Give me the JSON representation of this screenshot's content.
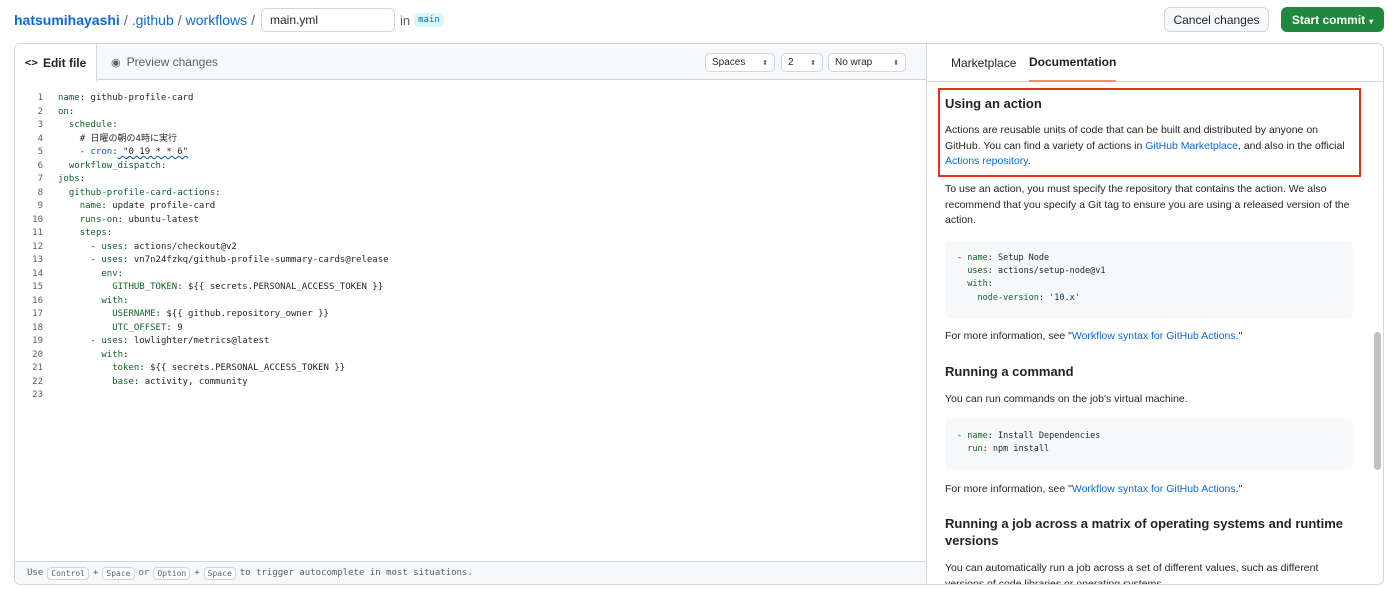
{
  "breadcrumb": {
    "owner": "hatsumihayashi",
    "dir1": ".github",
    "dir2": "workflows",
    "sep": "/",
    "filename": "main.yml",
    "in_text": "in",
    "branch": "main"
  },
  "actions": {
    "cancel": "Cancel changes",
    "commit": "Start commit",
    "commit_caret": "▾"
  },
  "editor": {
    "tab_edit": "Edit file",
    "tab_edit_icon": "<>",
    "tab_preview": "Preview changes",
    "tab_preview_icon": "◉",
    "indent_mode": "Spaces",
    "indent_size": "2",
    "wrap_mode": "No wrap",
    "select_arrow": "⬍",
    "footer": {
      "use": "Use",
      "key1": "Control",
      "plus1": "+",
      "key2": "Space",
      "or": "or",
      "key3": "Option",
      "plus2": "+",
      "key4": "Space",
      "tail": "to trigger autocomplete in most situations."
    }
  },
  "code_lines": [
    {
      "n": "1",
      "indent": "",
      "key": "name",
      "val": " github-profile-card"
    },
    {
      "n": "2",
      "indent": "",
      "key": "on",
      "val": ""
    },
    {
      "n": "3",
      "indent": "  ",
      "key": "schedule",
      "val": ""
    },
    {
      "n": "4",
      "indent": "    ",
      "key": "",
      "val": "# 日曜の朝の4時に実行"
    },
    {
      "n": "5",
      "indent": "    - ",
      "key": "cron",
      "val": " \"0 19 * * 6\""
    },
    {
      "n": "6",
      "indent": "  ",
      "key": "workflow_dispatch",
      "val": ""
    },
    {
      "n": "7",
      "indent": "",
      "key": "jobs",
      "val": ""
    },
    {
      "n": "8",
      "indent": "  ",
      "key": "github-profile-card-actions",
      "val": ""
    },
    {
      "n": "9",
      "indent": "    ",
      "key": "name",
      "val": " update profile-card"
    },
    {
      "n": "10",
      "indent": "    ",
      "key": "runs-on",
      "val": " ubuntu-latest"
    },
    {
      "n": "11",
      "indent": "    ",
      "key": "steps",
      "val": ""
    },
    {
      "n": "12",
      "indent": "      - ",
      "key": "uses",
      "val": " actions/checkout@v2"
    },
    {
      "n": "13",
      "indent": "      - ",
      "key": "uses",
      "val": " vn7n24fzkq/github-profile-summary-cards@release"
    },
    {
      "n": "14",
      "indent": "        ",
      "key": "env",
      "val": ""
    },
    {
      "n": "15",
      "indent": "          ",
      "key": "GITHUB_TOKEN",
      "val": " ${{ secrets.PERSONAL_ACCESS_TOKEN }}"
    },
    {
      "n": "16",
      "indent": "        ",
      "key": "with",
      "val": ""
    },
    {
      "n": "17",
      "indent": "          ",
      "key": "USERNAME",
      "val": " ${{ github.repository_owner }}"
    },
    {
      "n": "18",
      "indent": "          ",
      "key": "UTC_OFFSET",
      "val": " 9"
    },
    {
      "n": "19",
      "indent": "      - ",
      "key": "uses",
      "val": " lowlighter/metrics@latest"
    },
    {
      "n": "20",
      "indent": "        ",
      "key": "with",
      "val": ""
    },
    {
      "n": "21",
      "indent": "          ",
      "key": "token",
      "val": " ${{ secrets.PERSONAL_ACCESS_TOKEN }}"
    },
    {
      "n": "22",
      "indent": "          ",
      "key": "base",
      "val": " activity, community"
    },
    {
      "n": "23",
      "indent": "",
      "key": "",
      "val": ""
    }
  ],
  "docs": {
    "tab_marketplace": "Marketplace",
    "tab_documentation": "Documentation",
    "s1_title": "Using an action",
    "s1_p1_a": "Actions are reusable units of code that can be built and distributed by anyone on GitHub. You can find a variety of actions in ",
    "s1_p1_link1": "GitHub Marketplace",
    "s1_p1_b": ", and also in the official ",
    "s1_p1_link2": "Actions repository",
    "s1_p1_c": ".",
    "s1_p2": "To use an action, you must specify the repository that contains the action. We also recommend that you specify a Git tag to ensure you are using a released version of the action.",
    "code1": [
      {
        "pre": "- ",
        "key": "name",
        "val": " Setup Node",
        "str": false
      },
      {
        "pre": "  ",
        "key": "uses",
        "val": " actions/setup-node@v1",
        "str": false
      },
      {
        "pre": "  ",
        "key": "with",
        "val": "",
        "str": false
      },
      {
        "pre": "    ",
        "key": "node-version",
        "val": " '10.x'",
        "str": true
      }
    ],
    "more_info_prefix": "For more information, see \"",
    "more_info_link": "Workflow syntax for GitHub Actions",
    "more_info_suffix": ".\"",
    "s2_title": "Running a command",
    "s2_p1": "You can run commands on the job's virtual machine.",
    "code2": [
      {
        "pre": "- ",
        "key": "name",
        "val": " Install Dependencies",
        "str": false
      },
      {
        "pre": "  ",
        "key": "run",
        "val": " npm install",
        "str": false
      }
    ],
    "s3_title": "Running a job across a matrix of operating systems and runtime versions",
    "s3_p1": "You can automatically run a job across a set of different values, such as different versions of code libraries or operating systems."
  },
  "colors": {
    "link": "#0969da",
    "commit_green": "#1f883d",
    "highlight_red": "#e5331b",
    "active_tab_underline": "#fd8c73"
  }
}
